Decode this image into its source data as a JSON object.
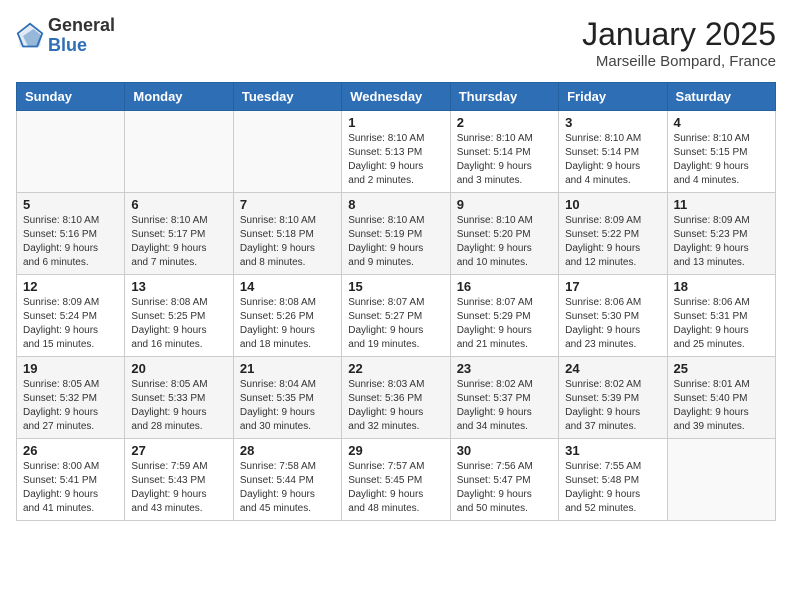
{
  "header": {
    "logo_general": "General",
    "logo_blue": "Blue",
    "month_title": "January 2025",
    "location": "Marseille Bompard, France"
  },
  "days_of_week": [
    "Sunday",
    "Monday",
    "Tuesday",
    "Wednesday",
    "Thursday",
    "Friday",
    "Saturday"
  ],
  "weeks": [
    [
      {
        "day": "",
        "info": ""
      },
      {
        "day": "",
        "info": ""
      },
      {
        "day": "",
        "info": ""
      },
      {
        "day": "1",
        "info": "Sunrise: 8:10 AM\nSunset: 5:13 PM\nDaylight: 9 hours\nand 2 minutes."
      },
      {
        "day": "2",
        "info": "Sunrise: 8:10 AM\nSunset: 5:14 PM\nDaylight: 9 hours\nand 3 minutes."
      },
      {
        "day": "3",
        "info": "Sunrise: 8:10 AM\nSunset: 5:14 PM\nDaylight: 9 hours\nand 4 minutes."
      },
      {
        "day": "4",
        "info": "Sunrise: 8:10 AM\nSunset: 5:15 PM\nDaylight: 9 hours\nand 4 minutes."
      }
    ],
    [
      {
        "day": "5",
        "info": "Sunrise: 8:10 AM\nSunset: 5:16 PM\nDaylight: 9 hours\nand 6 minutes."
      },
      {
        "day": "6",
        "info": "Sunrise: 8:10 AM\nSunset: 5:17 PM\nDaylight: 9 hours\nand 7 minutes."
      },
      {
        "day": "7",
        "info": "Sunrise: 8:10 AM\nSunset: 5:18 PM\nDaylight: 9 hours\nand 8 minutes."
      },
      {
        "day": "8",
        "info": "Sunrise: 8:10 AM\nSunset: 5:19 PM\nDaylight: 9 hours\nand 9 minutes."
      },
      {
        "day": "9",
        "info": "Sunrise: 8:10 AM\nSunset: 5:20 PM\nDaylight: 9 hours\nand 10 minutes."
      },
      {
        "day": "10",
        "info": "Sunrise: 8:09 AM\nSunset: 5:22 PM\nDaylight: 9 hours\nand 12 minutes."
      },
      {
        "day": "11",
        "info": "Sunrise: 8:09 AM\nSunset: 5:23 PM\nDaylight: 9 hours\nand 13 minutes."
      }
    ],
    [
      {
        "day": "12",
        "info": "Sunrise: 8:09 AM\nSunset: 5:24 PM\nDaylight: 9 hours\nand 15 minutes."
      },
      {
        "day": "13",
        "info": "Sunrise: 8:08 AM\nSunset: 5:25 PM\nDaylight: 9 hours\nand 16 minutes."
      },
      {
        "day": "14",
        "info": "Sunrise: 8:08 AM\nSunset: 5:26 PM\nDaylight: 9 hours\nand 18 minutes."
      },
      {
        "day": "15",
        "info": "Sunrise: 8:07 AM\nSunset: 5:27 PM\nDaylight: 9 hours\nand 19 minutes."
      },
      {
        "day": "16",
        "info": "Sunrise: 8:07 AM\nSunset: 5:29 PM\nDaylight: 9 hours\nand 21 minutes."
      },
      {
        "day": "17",
        "info": "Sunrise: 8:06 AM\nSunset: 5:30 PM\nDaylight: 9 hours\nand 23 minutes."
      },
      {
        "day": "18",
        "info": "Sunrise: 8:06 AM\nSunset: 5:31 PM\nDaylight: 9 hours\nand 25 minutes."
      }
    ],
    [
      {
        "day": "19",
        "info": "Sunrise: 8:05 AM\nSunset: 5:32 PM\nDaylight: 9 hours\nand 27 minutes."
      },
      {
        "day": "20",
        "info": "Sunrise: 8:05 AM\nSunset: 5:33 PM\nDaylight: 9 hours\nand 28 minutes."
      },
      {
        "day": "21",
        "info": "Sunrise: 8:04 AM\nSunset: 5:35 PM\nDaylight: 9 hours\nand 30 minutes."
      },
      {
        "day": "22",
        "info": "Sunrise: 8:03 AM\nSunset: 5:36 PM\nDaylight: 9 hours\nand 32 minutes."
      },
      {
        "day": "23",
        "info": "Sunrise: 8:02 AM\nSunset: 5:37 PM\nDaylight: 9 hours\nand 34 minutes."
      },
      {
        "day": "24",
        "info": "Sunrise: 8:02 AM\nSunset: 5:39 PM\nDaylight: 9 hours\nand 37 minutes."
      },
      {
        "day": "25",
        "info": "Sunrise: 8:01 AM\nSunset: 5:40 PM\nDaylight: 9 hours\nand 39 minutes."
      }
    ],
    [
      {
        "day": "26",
        "info": "Sunrise: 8:00 AM\nSunset: 5:41 PM\nDaylight: 9 hours\nand 41 minutes."
      },
      {
        "day": "27",
        "info": "Sunrise: 7:59 AM\nSunset: 5:43 PM\nDaylight: 9 hours\nand 43 minutes."
      },
      {
        "day": "28",
        "info": "Sunrise: 7:58 AM\nSunset: 5:44 PM\nDaylight: 9 hours\nand 45 minutes."
      },
      {
        "day": "29",
        "info": "Sunrise: 7:57 AM\nSunset: 5:45 PM\nDaylight: 9 hours\nand 48 minutes."
      },
      {
        "day": "30",
        "info": "Sunrise: 7:56 AM\nSunset: 5:47 PM\nDaylight: 9 hours\nand 50 minutes."
      },
      {
        "day": "31",
        "info": "Sunrise: 7:55 AM\nSunset: 5:48 PM\nDaylight: 9 hours\nand 52 minutes."
      },
      {
        "day": "",
        "info": ""
      }
    ]
  ]
}
